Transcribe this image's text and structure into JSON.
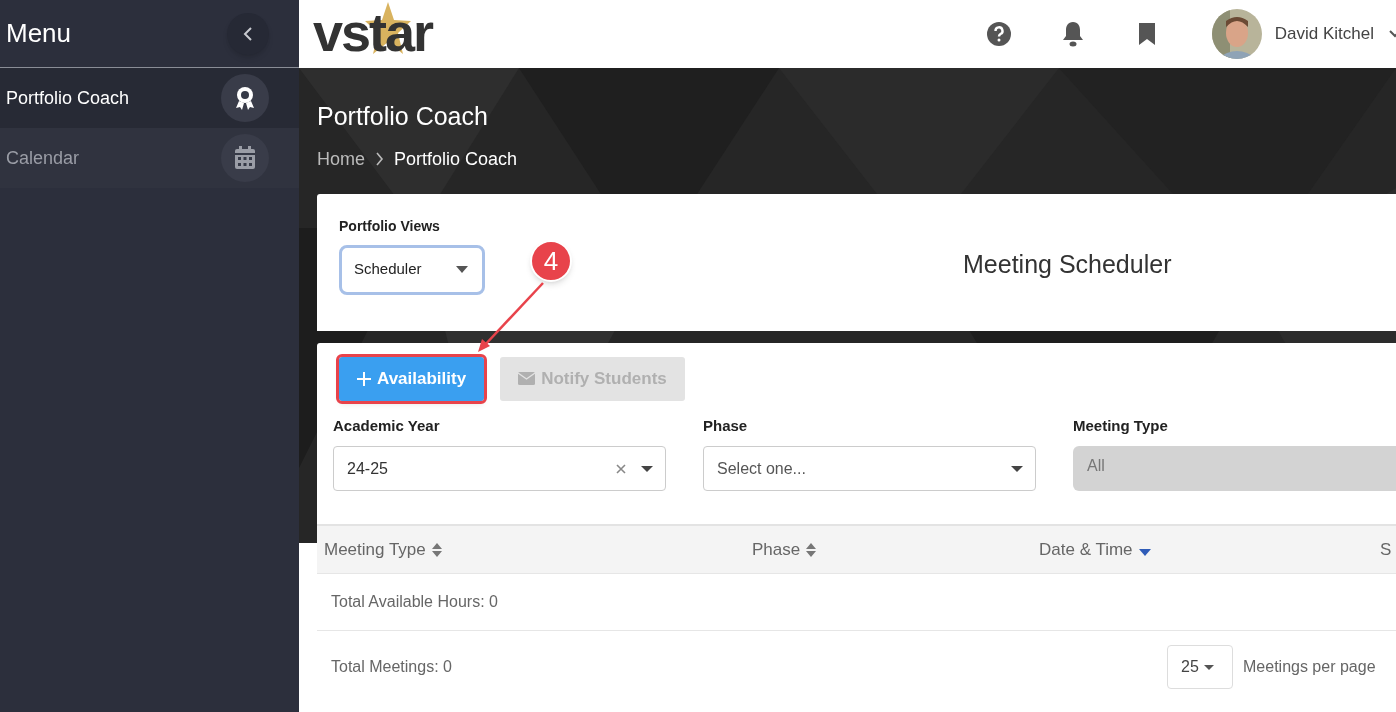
{
  "sidebar": {
    "title": "Menu",
    "items": [
      {
        "label": "Portfolio Coach",
        "selected": true
      },
      {
        "label": "Calendar",
        "selected": false
      }
    ]
  },
  "header": {
    "logo": "vstar",
    "user_name": "David Kitchel"
  },
  "page": {
    "title": "Portfolio Coach",
    "breadcrumb": [
      "Home",
      "Portfolio Coach"
    ]
  },
  "views": {
    "label": "Portfolio Views",
    "value": "Scheduler",
    "heading": "Meeting Scheduler"
  },
  "buttons": [
    {
      "label": "Availability",
      "disabled": false,
      "highlighted": true
    },
    {
      "label": "Notify Students",
      "disabled": true,
      "highlighted": false
    }
  ],
  "filters": [
    {
      "label": "Academic Year",
      "value": "24-25",
      "clearable": true,
      "disabled": false
    },
    {
      "label": "Phase",
      "placeholder": "Select one...",
      "clearable": false,
      "disabled": false
    },
    {
      "label": "Meeting Type",
      "value": "All",
      "clearable": false,
      "disabled": true
    }
  ],
  "table": {
    "columns": [
      {
        "label": "Meeting Type",
        "sorted": false
      },
      {
        "label": "Phase",
        "sorted": false
      },
      {
        "label": "Date & Time",
        "sorted": true
      },
      {
        "label": "S"
      }
    ],
    "summary": "Total Available Hours: 0"
  },
  "footer": {
    "total": "Total Meetings: 0",
    "page_size": "25",
    "page_size_label": "Meetings per page"
  },
  "callout": {
    "label": "4"
  }
}
